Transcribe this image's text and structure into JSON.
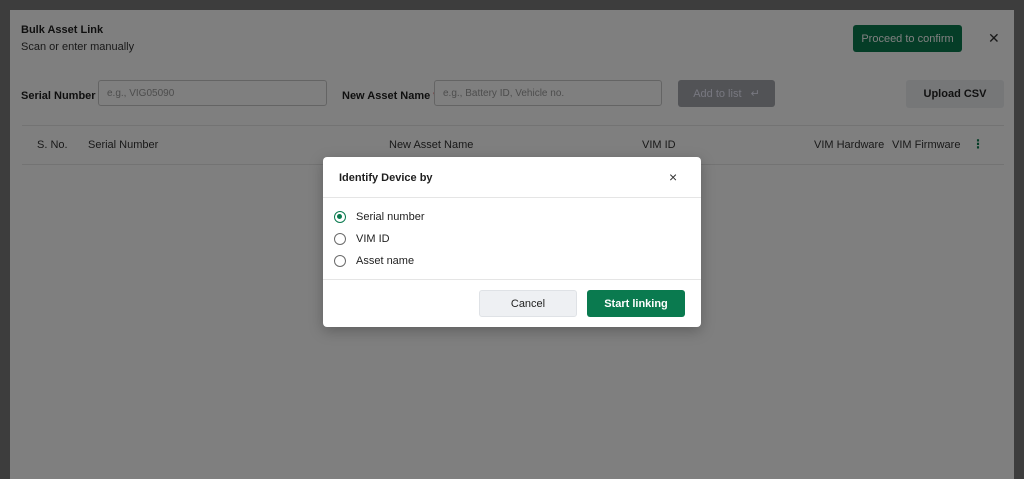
{
  "header": {
    "title": "Bulk Asset Link",
    "subtitle": "Scan or enter manually",
    "proceed_label": "Proceed to confirm",
    "close_icon": "close-icon"
  },
  "form": {
    "serial_label": "Serial Number",
    "serial_placeholder": "e.g., VIG05090",
    "asset_label": "New Asset Name",
    "asset_placeholder": "e.g., Battery ID, Vehicle no.",
    "required_marker": "*",
    "add_label": "Add to list",
    "add_icon": "↵",
    "upload_label": "Upload CSV"
  },
  "table": {
    "columns": [
      "S. No.",
      "Serial Number",
      "New Asset Name",
      "VIM ID",
      "VIM Hardware",
      "VIM Firmware"
    ],
    "menu_icon": "⋮"
  },
  "modal": {
    "title": "Identify Device by",
    "close_icon": "×",
    "options": [
      {
        "label": "Serial number",
        "selected": true
      },
      {
        "label": "VIM ID",
        "selected": false
      },
      {
        "label": "Asset name",
        "selected": false
      }
    ],
    "cancel_label": "Cancel",
    "start_label": "Start linking"
  },
  "colors": {
    "primary": "#0a7a4f",
    "required": "#d32f2f"
  }
}
